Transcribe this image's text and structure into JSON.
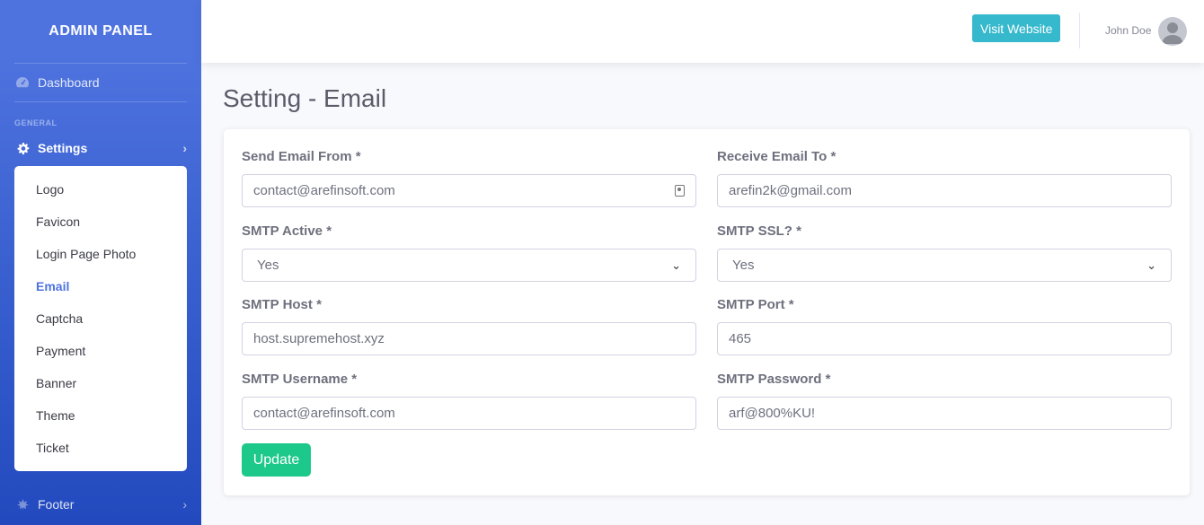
{
  "brand": "ADMIN PANEL",
  "sidebar": {
    "dashboard": "Dashboard",
    "heading": "GENERAL",
    "settings": "Settings",
    "submenu": [
      "Logo",
      "Favicon",
      "Login Page Photo",
      "Email",
      "Captcha",
      "Payment",
      "Banner",
      "Theme",
      "Ticket"
    ],
    "active_submenu": "Email",
    "footer": "Footer"
  },
  "topbar": {
    "visit_button": "Visit Website",
    "user_name": "John Doe"
  },
  "page_title": "Setting - Email",
  "form": {
    "send_from": {
      "label": "Send Email From *",
      "value": "contact@arefinsoft.com"
    },
    "receive_to": {
      "label": "Receive Email To *",
      "value": "arefin2k@gmail.com"
    },
    "smtp_active": {
      "label": "SMTP Active *",
      "value": "Yes"
    },
    "smtp_ssl": {
      "label": "SMTP SSL? *",
      "value": "Yes"
    },
    "smtp_host": {
      "label": "SMTP Host *",
      "value": "host.supremehost.xyz"
    },
    "smtp_port": {
      "label": "SMTP Port *",
      "value": "465"
    },
    "smtp_username": {
      "label": "SMTP Username *",
      "value": "contact@arefinsoft.com"
    },
    "smtp_password": {
      "label": "SMTP Password *",
      "value": "arf@800%KU!"
    },
    "update_button": "Update"
  },
  "colors": {
    "sidebar_start": "#4e73df",
    "sidebar_end": "#224abe",
    "visit_button": "#36b9cc",
    "update_button": "#1cc88a",
    "active_link": "#4e73df"
  },
  "icons": {
    "dashboard": "tachometer-icon",
    "settings": "gear-icon",
    "footer": "leaf-icon",
    "chevron": "chevron-right-icon"
  }
}
